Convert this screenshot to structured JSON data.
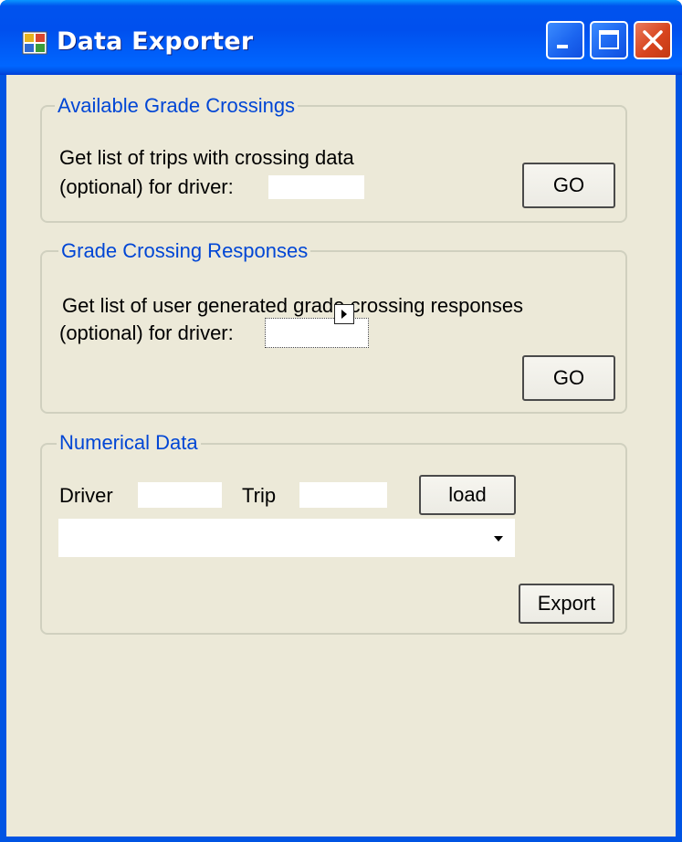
{
  "window": {
    "title": "Data Exporter"
  },
  "groups": {
    "available": {
      "title": "Available Grade Crossings",
      "line1": "Get list of trips with crossing data",
      "line2": "(optional) for driver:",
      "driver_value": "",
      "go_label": "GO"
    },
    "responses": {
      "title": "Grade Crossing Responses",
      "line1": "Get list of user generated grade crossing responses",
      "line2": "(optional) for driver:",
      "driver_value": "",
      "go_label": "GO"
    },
    "numerical": {
      "title": "Numerical Data",
      "driver_label": "Driver",
      "trip_label": "Trip",
      "driver_value": "",
      "trip_value": "",
      "load_label": "load",
      "combo_selected": "",
      "export_label": "Export"
    }
  },
  "icons": {
    "app": "app-window-icon",
    "minimize": "minimize-icon",
    "maximize": "maximize-icon",
    "close": "close-icon",
    "combo": "chevron-down-icon"
  },
  "colors": {
    "titlebar": "#0054e3",
    "client_bg": "#ece9d8",
    "group_title": "#0046d5",
    "close_button": "#d8451f"
  }
}
